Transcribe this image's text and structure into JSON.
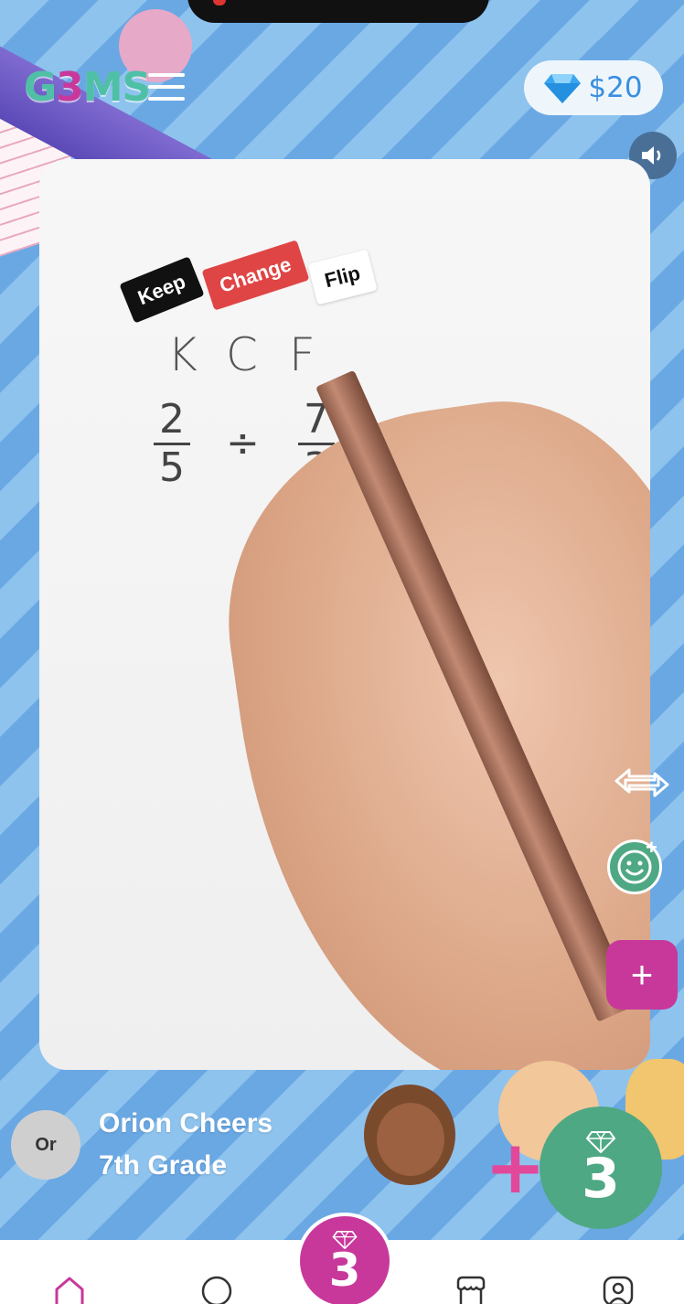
{
  "app": {
    "logo_prefix": "G",
    "logo_three": "3",
    "logo_suffix": "MS"
  },
  "header": {
    "balance": "$20"
  },
  "video": {
    "tags": {
      "keep": "Keep",
      "change": "Change",
      "flip": "Flip"
    },
    "letters": "KCF",
    "fraction_left": {
      "num": "2",
      "den": "5"
    },
    "operator": "÷",
    "fraction_right": {
      "num": "7",
      "den": "3"
    }
  },
  "actions": {
    "add_label": "+"
  },
  "user": {
    "avatar_initials": "Or",
    "name": "Orion Cheers",
    "grade": "7th Grade"
  },
  "gem_badge": {
    "count": "3"
  },
  "tabbar": {
    "center_count": "3",
    "icons": [
      "home-icon",
      "search-icon",
      "gem-icon",
      "store-icon",
      "profile-icon"
    ]
  },
  "colors": {
    "accent_green": "#4ea883",
    "accent_pink": "#c8389b",
    "balance_blue": "#3a8fe0"
  }
}
